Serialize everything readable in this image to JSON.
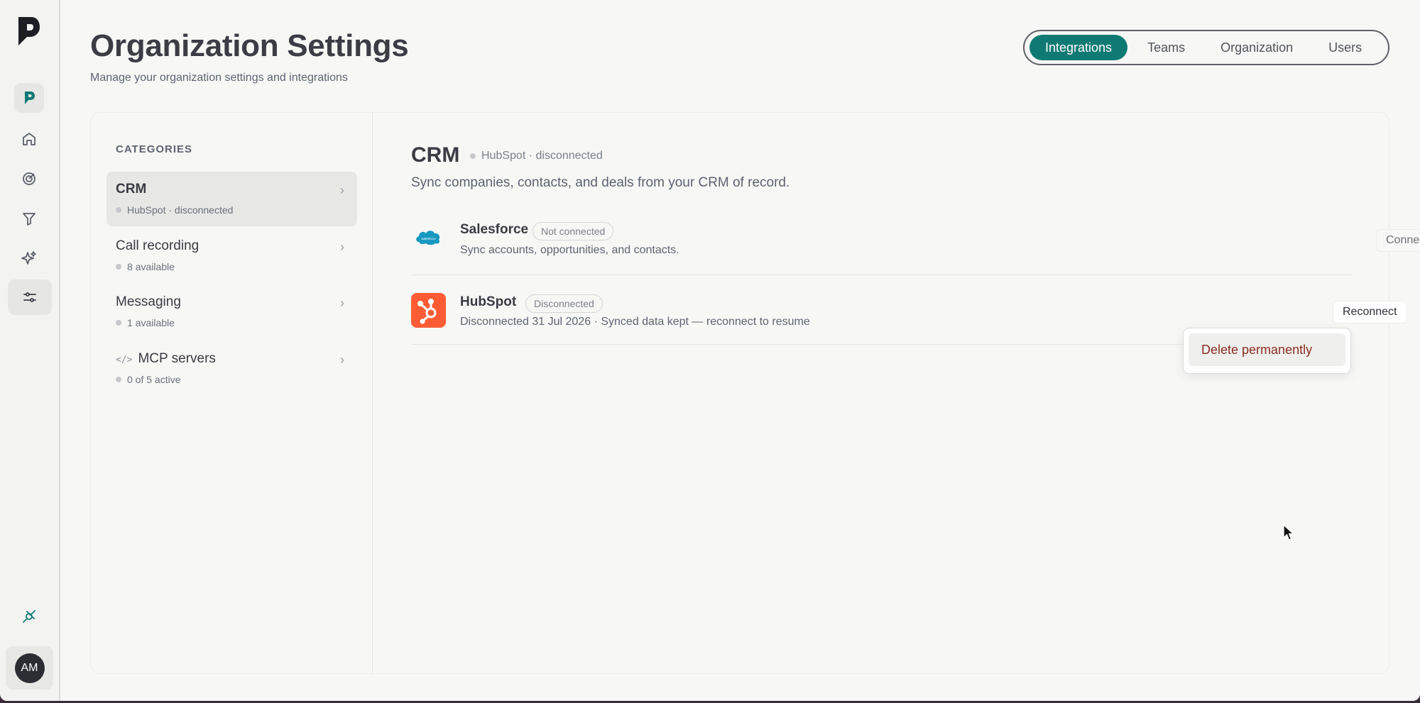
{
  "rail": {
    "user_initials": "AM"
  },
  "header": {
    "title": "Organization Settings",
    "subtitle": "Manage your organization settings and integrations"
  },
  "tabs": [
    {
      "label": "Integrations",
      "active": true
    },
    {
      "label": "Teams",
      "active": false
    },
    {
      "label": "Organization",
      "active": false
    },
    {
      "label": "Users",
      "active": false
    }
  ],
  "categories": {
    "heading": "CATEGORIES",
    "items": [
      {
        "name": "CRM",
        "sub": "HubSpot · disconnected",
        "active": true
      },
      {
        "name": "Call recording",
        "sub": "8 available",
        "active": false
      },
      {
        "name": "Messaging",
        "sub": "1 available",
        "active": false
      },
      {
        "name": "MCP servers",
        "sub": "0 of 5 active",
        "active": false,
        "icon": "code-icon"
      }
    ]
  },
  "content": {
    "title": "CRM",
    "status": "HubSpot · disconnected",
    "description": "Sync companies, contacts, and deals from your CRM of record.",
    "integrations": [
      {
        "name": "Salesforce",
        "badge": "Not connected",
        "description": "Sync accounts, opportunities, and contacts.",
        "action": "Connect",
        "logo_text": "salesforce",
        "logo_color": "#1798c1"
      },
      {
        "name": "HubSpot",
        "badge": "Disconnected",
        "description": "Disconnected 31 Jul 2026 · Synced data kept — reconnect to resume",
        "action": "Reconnect",
        "more": "···",
        "logo_color": "#ff5c35"
      }
    ]
  },
  "dropdown": {
    "items": [
      {
        "label": "Delete permanently"
      }
    ]
  },
  "colors": {
    "accent": "#0f7a73",
    "danger": "#8a2e22",
    "hubspot": "#ff5c35",
    "salesforce": "#1798c1"
  }
}
